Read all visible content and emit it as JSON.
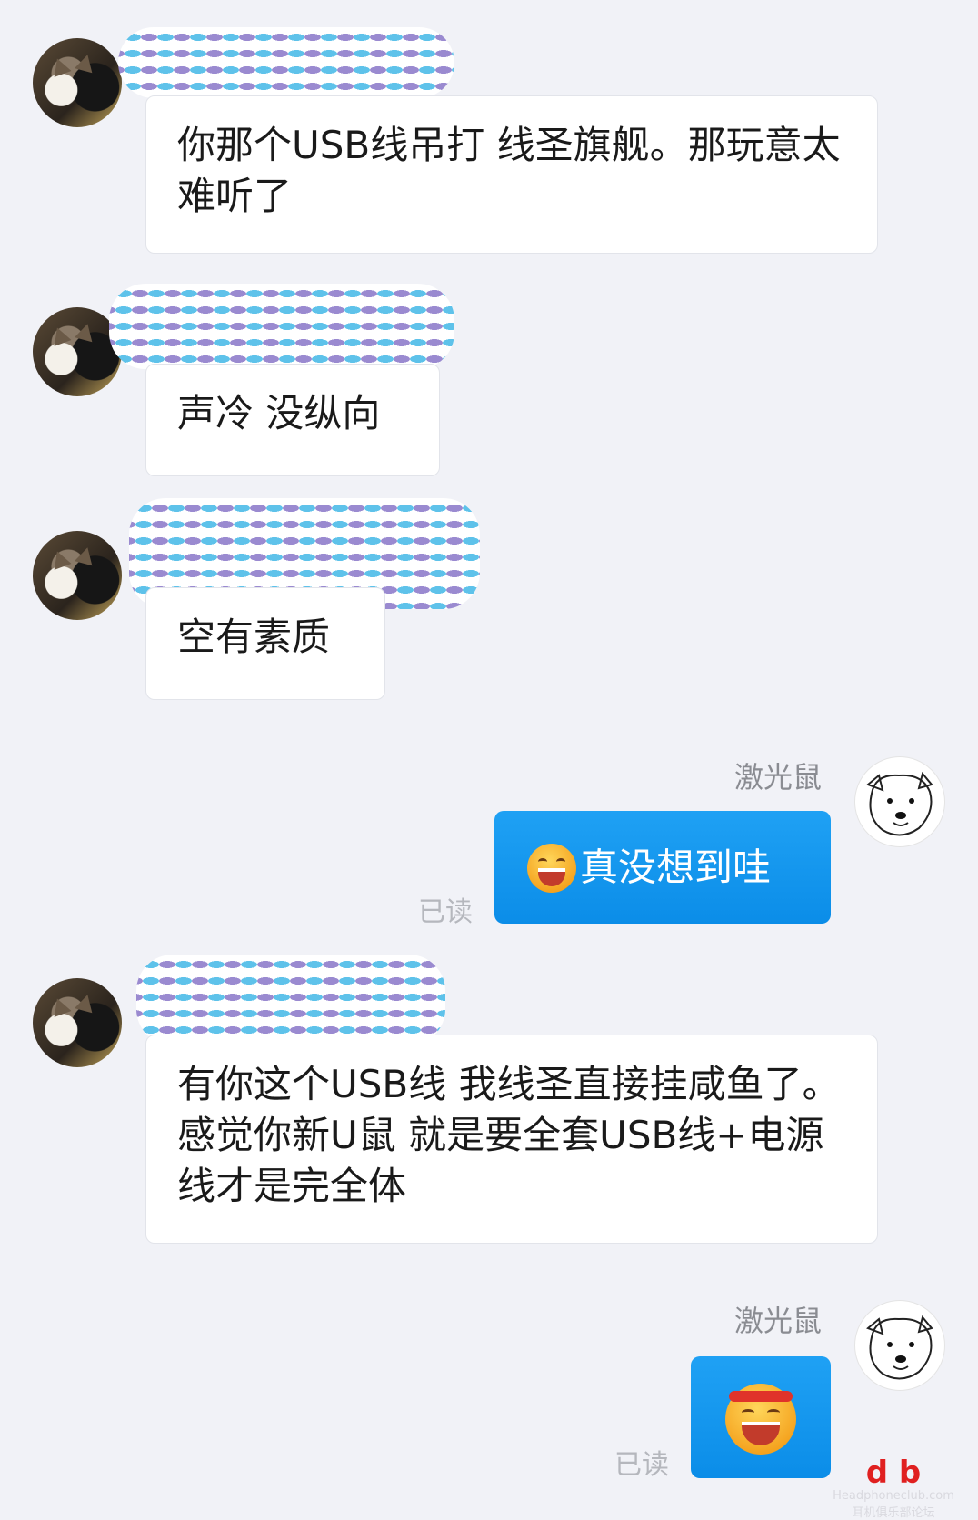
{
  "messages": [
    {
      "text": "你那个USB线吊打 线圣旗舰。那玩意太难听了"
    },
    {
      "text": "声冷 没纵向"
    },
    {
      "text": "空有素质"
    },
    {
      "sender": "激光鼠",
      "text": "真没想到哇",
      "emoji": "grinning-sweat-emoji",
      "status": "已读"
    },
    {
      "text": "有你这个USB线 我线圣直接挂咸鱼了。感觉你新U鼠 就是要全套USB线+电源线才是完全体"
    },
    {
      "sender": "激光鼠",
      "emoji": "headband-laughing-emoji",
      "status": "已读"
    }
  ],
  "colors": {
    "outgoing_bubble": "#1b9cf2",
    "incoming_bubble": "#ffffff",
    "background": "#f1f2f7",
    "name_mask_blue": "#5ec2ea",
    "name_mask_purple": "#9a8ad0"
  },
  "watermark": {
    "logo_text": "d  b",
    "site_text": "Headphoneclub.com",
    "caption": "耳机俱乐部论坛"
  }
}
